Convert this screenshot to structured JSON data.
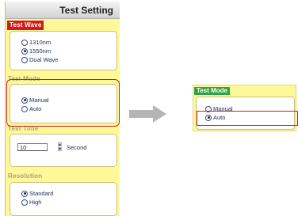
{
  "panel": {
    "title": "Test Setting",
    "test_wave": {
      "label": "Test Wave",
      "options": [
        "1310nm",
        "1550nm",
        "Dual Wave"
      ],
      "selected": "1550nm"
    },
    "test_mode": {
      "label": "Test Mode",
      "options": [
        "Manual",
        "Auto"
      ],
      "selected": "Manual"
    },
    "test_time": {
      "label": "Test Time",
      "value": "10",
      "unit": "Second"
    },
    "resolution": {
      "label": "Resolution",
      "options": [
        "Standard",
        "High"
      ],
      "selected": "Standard"
    }
  },
  "zoom": {
    "label": "Test Mode",
    "options": [
      "Manual",
      "Auto"
    ],
    "selected": "Auto"
  },
  "colors": {
    "panel_bg": "#fff899",
    "highlight": "#c62020",
    "zoom_label_bg": "#2ea344",
    "wave_label_bg": "#d21a1a",
    "arrow": "#b5b5b5"
  },
  "icons": {
    "arrow": "right-arrow-icon",
    "spin_up": "spin-up-icon",
    "spin_down": "spin-down-icon"
  }
}
